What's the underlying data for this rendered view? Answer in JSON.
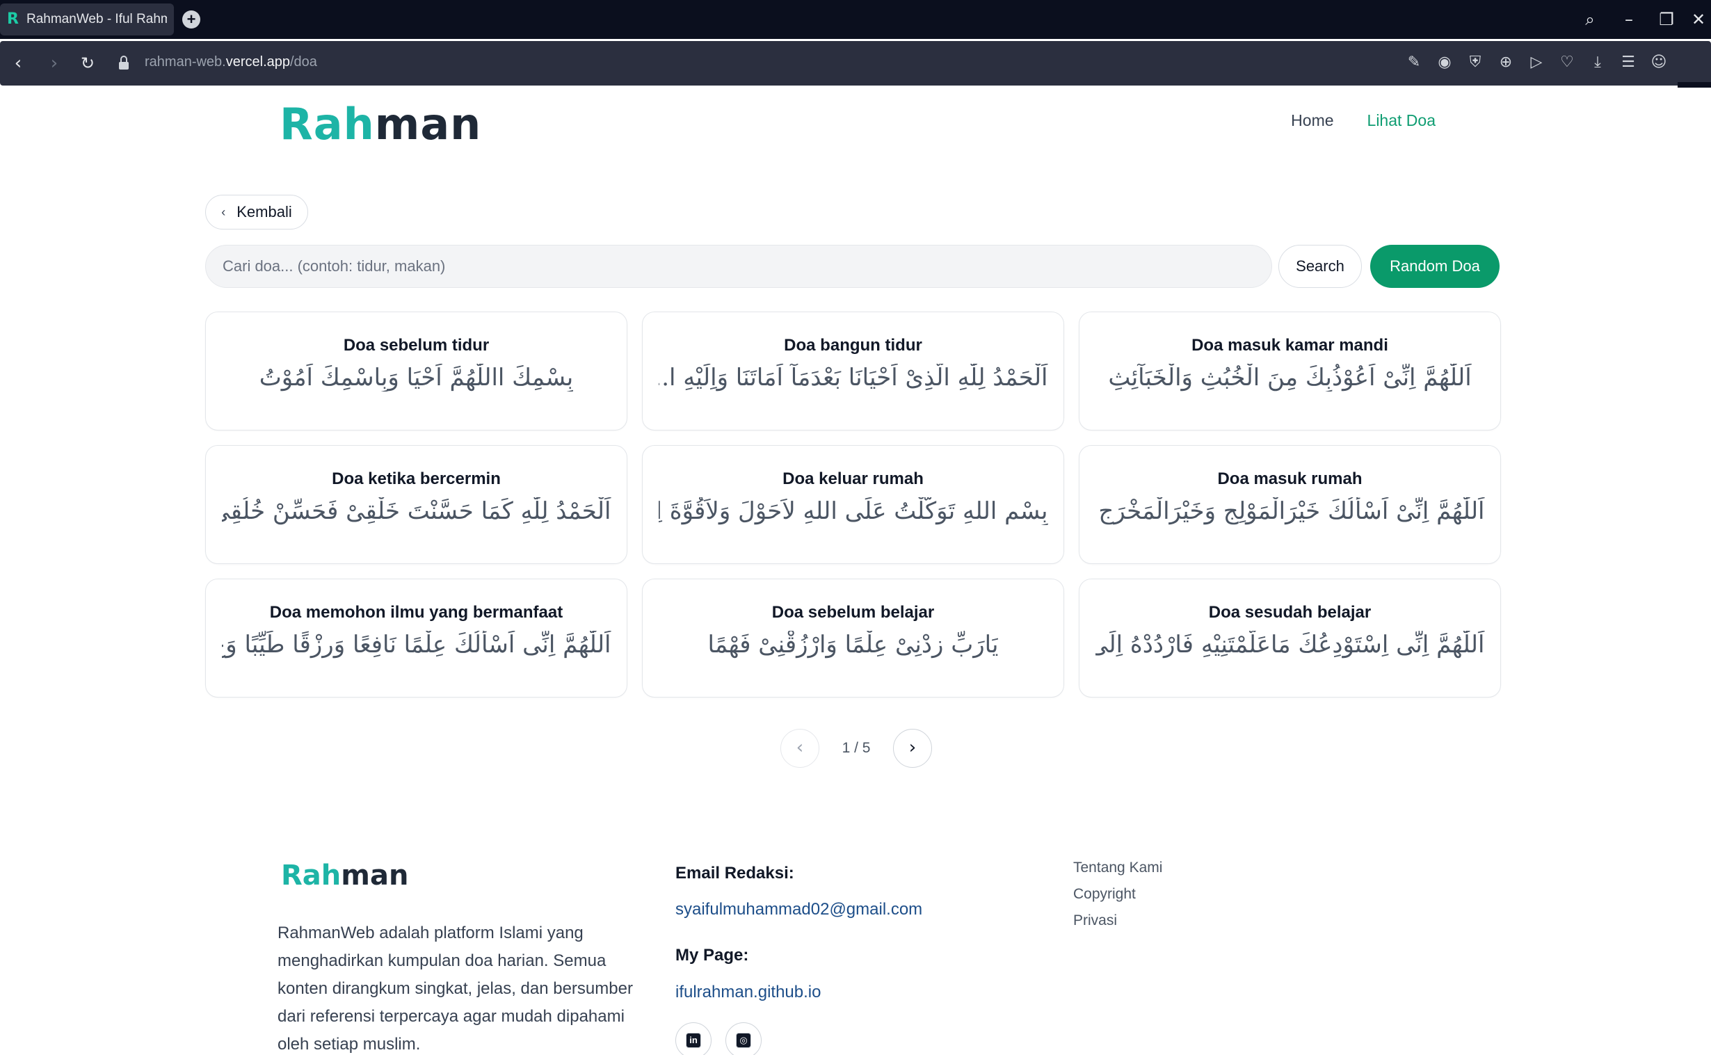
{
  "browser": {
    "tab_title": "RahmanWeb - Iful Rahman",
    "url_prefix": "rahman-web.",
    "url_domain": "vercel.app",
    "url_path": "/doa"
  },
  "header": {
    "logo_part1": "Rah",
    "logo_part2": "man",
    "nav": {
      "home": "Home",
      "lihat_doa": "Lihat Doa"
    }
  },
  "back_label": "Kembali",
  "search": {
    "placeholder": "Cari doa... (contoh: tidur, makan)",
    "button": "Search",
    "random_button": "Random Doa"
  },
  "doa_cards": [
    {
      "title": "Doa sebelum tidur",
      "arabic": "بِسْمِكَ االلّٰهُمَّ اَحْيَا وَبِاسْمِكَ اَمُوْتُ"
    },
    {
      "title": "Doa bangun tidur",
      "arabic": "اَلْحَمْدُ لِلّٰهِ الَّذِىْ اَحْيَانَا بَعْدَمَآ اَمَاتَنَا وَاِلَيْهِ ا..."
    },
    {
      "title": "Doa masuk kamar mandi",
      "arabic": "اَللّٰهُمَّ اِنِّىْ اَعُوْذُبِكَ مِنَ الْخُبُثِ وَالْخَبَآئِثِ"
    },
    {
      "title": "Doa ketika bercermin",
      "arabic": "اَلْحَمْدُ لِلّٰهِ كَمَا حَسَّنْتَ خَلْقِىْ فَحَسِّنْ خُلُقِىْ"
    },
    {
      "title": "Doa keluar rumah",
      "arabic": "بِسْمِ اللهِ تَوَكَّلْتُ عَلَى اللهِ لاَحَوْلَ وَلاَقُوَّةَ اِلاَّ بِا..."
    },
    {
      "title": "Doa masuk rumah",
      "arabic": "اَللّٰهُمَّ اِنِّىْ اَسْأَلُكَ خَيْرَالْمَوْلِجِ وَخَيْرَالْمَخْرَجِ بِ..."
    },
    {
      "title": "Doa memohon ilmu yang bermanfaat",
      "arabic": "اَللّٰهُمَّ اِنِّى اَسْأَلُكَ عِلْمًا نَافِعًا وَرِزْقًا طَيِّبًا وَعَ..."
    },
    {
      "title": "Doa sebelum belajar",
      "arabic": "يَارَبِّ زِدْنِىْ عِلْمًا وَارْزُقْنِىْ فَهْمًا"
    },
    {
      "title": "Doa sesudah belajar",
      "arabic": "اَللّٰهُمَّ اِنِّى اِسْتَوْدِعُكَ مَاعَلَّمْتَنِيْهِ فَارْدُدْهُ اِلَى..."
    }
  ],
  "pagination": {
    "current": "1 / 5",
    "prev_icon": "chevron-left",
    "next_icon": "chevron-right"
  },
  "footer": {
    "logo_part1": "Rah",
    "logo_part2": "man",
    "description": "RahmanWeb adalah platform Islami yang menghadirkan kumpulan doa harian. Semua konten dirangkum singkat, jelas, dan bersumber dari referensi terpercaya agar mudah dipahami oleh setiap muslim.",
    "email_heading": "Email Redaksi:",
    "email": "syaifulmuhammad02@gmail.com",
    "page_heading": "My Page:",
    "page_link": "ifulrahman.github.io",
    "social": [
      "linkedin-icon",
      "instagram-icon"
    ],
    "menu": [
      "Tentang Kami",
      "Copyright",
      "Privasi"
    ]
  },
  "colors": {
    "brand_teal": "#1db4a6",
    "accent_green": "#0a9a6a",
    "nav_active": "#0f9d72"
  }
}
